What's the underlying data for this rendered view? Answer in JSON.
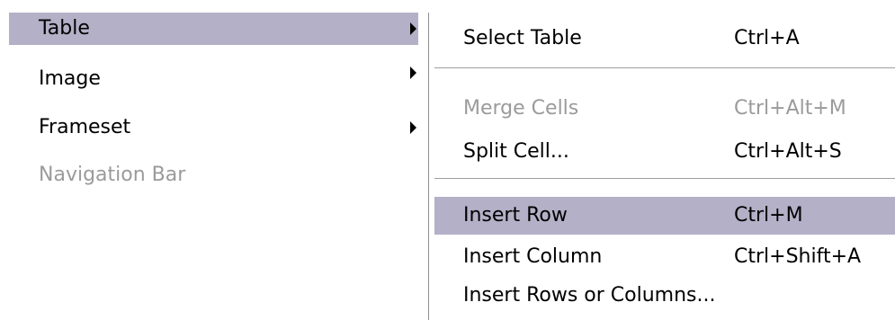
{
  "parent_menu": {
    "items": [
      {
        "label": "Table",
        "has_submenu": true,
        "highlighted": true,
        "enabled": true
      },
      {
        "label": "Image",
        "has_submenu": true,
        "highlighted": false,
        "enabled": true
      },
      {
        "label": "Frameset",
        "has_submenu": true,
        "highlighted": false,
        "enabled": true
      },
      {
        "label": "Navigation Bar",
        "has_submenu": false,
        "highlighted": false,
        "enabled": false
      }
    ]
  },
  "submenu": {
    "items": [
      {
        "label": "Select Table",
        "shortcut": "Ctrl+A",
        "enabled": true,
        "highlighted": false
      },
      {
        "label": "Merge Cells",
        "shortcut": "Ctrl+Alt+M",
        "enabled": false,
        "highlighted": false
      },
      {
        "label": "Split Cell...",
        "shortcut": "Ctrl+Alt+S",
        "enabled": true,
        "highlighted": false
      },
      {
        "label": "Insert Row",
        "shortcut": "Ctrl+M",
        "enabled": true,
        "highlighted": true
      },
      {
        "label": "Insert Column",
        "shortcut": "Ctrl+Shift+A",
        "enabled": true,
        "highlighted": false
      },
      {
        "label": "Insert Rows or Columns...",
        "shortcut": "",
        "enabled": true,
        "highlighted": false
      }
    ]
  },
  "colors": {
    "highlight": "#b3b0c7",
    "disabled_text": "#9c9a9a",
    "separator": "#9e9e9e"
  }
}
